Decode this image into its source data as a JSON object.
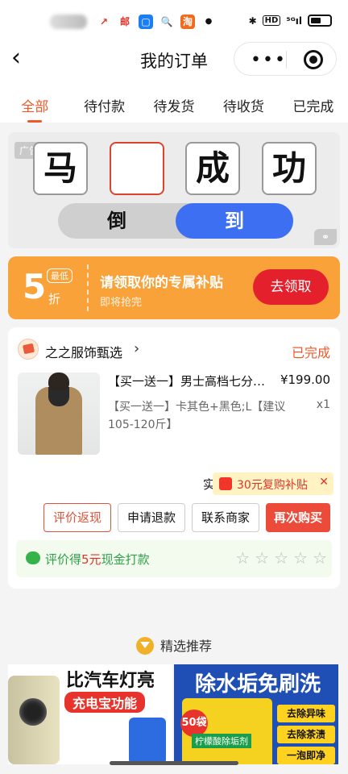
{
  "nav": {
    "title": "我的订单",
    "more": "•••"
  },
  "tabs": [
    {
      "label": "全部"
    },
    {
      "label": "待付款"
    },
    {
      "label": "待发货"
    },
    {
      "label": "待收货"
    },
    {
      "label": "已完成"
    }
  ],
  "ad": {
    "tag": "广告",
    "chars": [
      "马",
      "",
      "成",
      "功"
    ],
    "options": [
      "倒",
      "到"
    ]
  },
  "coupon": {
    "amount": "5",
    "min_label": "最低",
    "unit": "折",
    "title": "请领取你的专属补贴",
    "subtitle": "即将抢完",
    "claim": "去领取"
  },
  "order": {
    "shop_name": "之之服饰甄选",
    "status": "已完成",
    "product_title": "【买一送一】男士高档七分…",
    "price": "¥199.00",
    "spec": "【买一送一】卡其色+黑色;L【建议105-120斤】",
    "qty": "x1",
    "paid_prefix": "实",
    "repurchase_tip": "30元复购补贴",
    "buttons": {
      "review": "评价返现",
      "refund": "申请退款",
      "contact": "联系商家",
      "rebuy": "再次购买"
    },
    "review_bar": {
      "prefix": "评价得",
      "amount": "5元",
      "suffix": "现金打款"
    },
    "rating_stars": 0
  },
  "recommend": {
    "title": "精选推荐",
    "left": {
      "headline": "比汽车灯亮",
      "badge": "充电宝功能"
    },
    "right": {
      "headline": "除水垢免刷洗",
      "count": "50袋",
      "pack_name": "柠檬酸除垢剂",
      "features": [
        "去除异味",
        "去除茶渍",
        "一泡即净"
      ]
    }
  }
}
